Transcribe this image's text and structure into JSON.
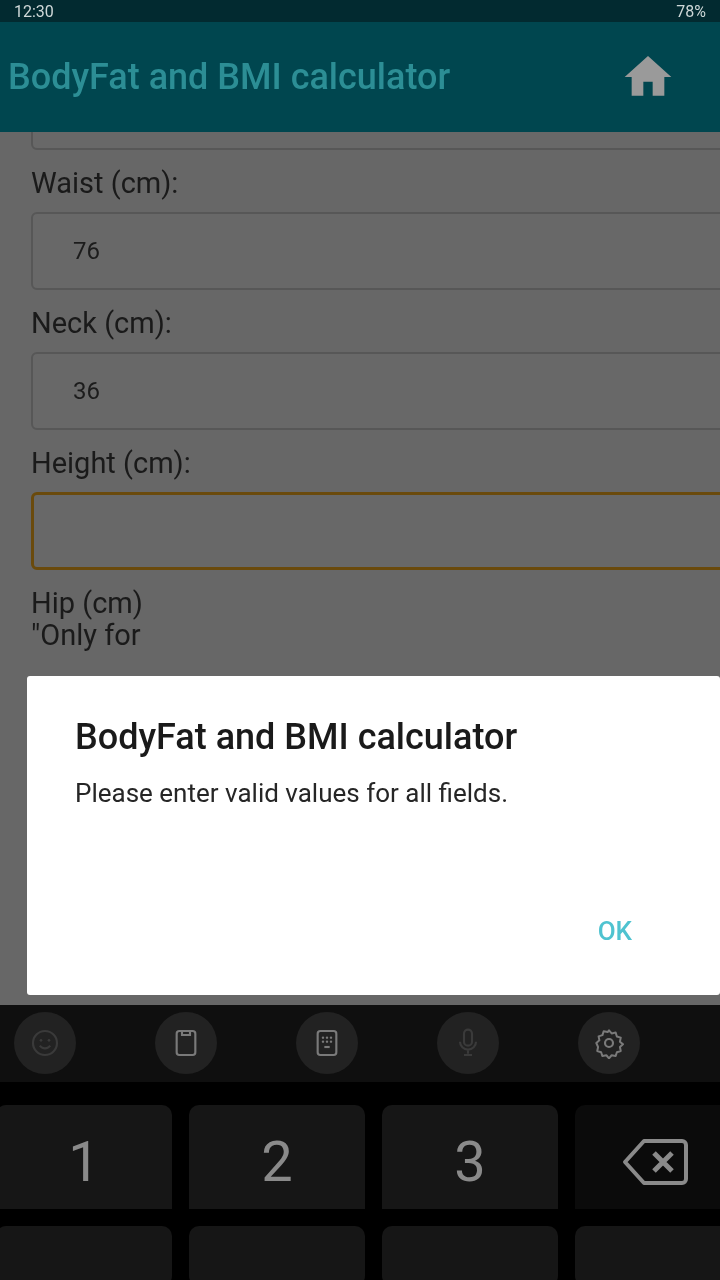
{
  "status_bar": {
    "time": "12:30",
    "battery": "78%"
  },
  "app_bar": {
    "title": "BodyFat and BMI calculator"
  },
  "form": {
    "fields": [
      {
        "focused": false
      },
      {
        "label": "Waist (cm):",
        "value": "76",
        "focused": false
      },
      {
        "label": "Neck (cm):",
        "value": "36",
        "focused": false
      },
      {
        "label": "Height (cm):",
        "focused": true
      }
    ],
    "hip_label": "Hip (cm)",
    "hip_note": "\"Only for"
  },
  "dialog": {
    "title": "BodyFat and BMI calculator",
    "message": "Please enter valid values for all fields.",
    "buttons": [
      "OK"
    ]
  },
  "keyboard": {
    "toolbar": [
      {
        "kind": "emoji",
        "disabled": true
      },
      {
        "kind": "clipboard",
        "disabled": false
      },
      {
        "kind": "keypad",
        "disabled": false
      },
      {
        "kind": "mic",
        "disabled": true
      },
      {
        "kind": "settings",
        "disabled": false
      }
    ],
    "keys": [
      {
        "kind": "digit",
        "label": "1"
      },
      {
        "kind": "digit",
        "label": "2"
      },
      {
        "kind": "digit",
        "label": "3"
      },
      {
        "kind": "backspace"
      }
    ]
  }
}
